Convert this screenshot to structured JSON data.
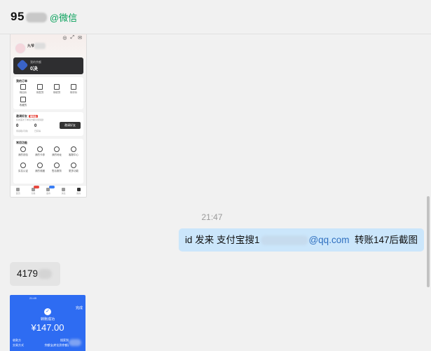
{
  "header": {
    "title": "95",
    "wechat_tag": "@微信"
  },
  "shot1": {
    "status_time": "9:41",
    "username": "九爷",
    "dark_label": "我的余额",
    "dark_value": "0决",
    "orders_title": "我的订单",
    "orders": [
      "待出价",
      "待发货",
      "待收货",
      "待评价",
      "收藏的"
    ],
    "invite_title": "邀请好友",
    "invite_tag": "赚现金",
    "invite_sub": "好友首次下单双方都享受奖励",
    "invite_stat1": "0",
    "invite_stat1_label": "待领取(可用)",
    "invite_stat2": "0",
    "invite_stat2_label": "已获得",
    "invite_button": "邀请好友",
    "services_title": "常用功能",
    "services": [
      "我的钱包",
      "我的卡券",
      "我的地址",
      "客服中心",
      "实名认证",
      "我的收藏",
      "售后服务",
      "更多功能"
    ],
    "tabs": [
      "首页",
      "分类",
      "发布",
      "消息",
      "我的"
    ]
  },
  "timestamp": "21:47",
  "messages": {
    "sent_prefix": "id  发来   支付宝搜1",
    "sent_email": "@qq.com",
    "sent_suffix": "转账147后截图",
    "received_prefix": "4179"
  },
  "shot2": {
    "status_left": "21:49",
    "done_label": "完成",
    "check": "✓",
    "success_label": "转账成功",
    "amount": "¥147.00",
    "payee_label": "收款方",
    "payee_value": "搜索到",
    "payment_label": "交易方式",
    "payment_value": "余额宝(转出到余额)"
  }
}
